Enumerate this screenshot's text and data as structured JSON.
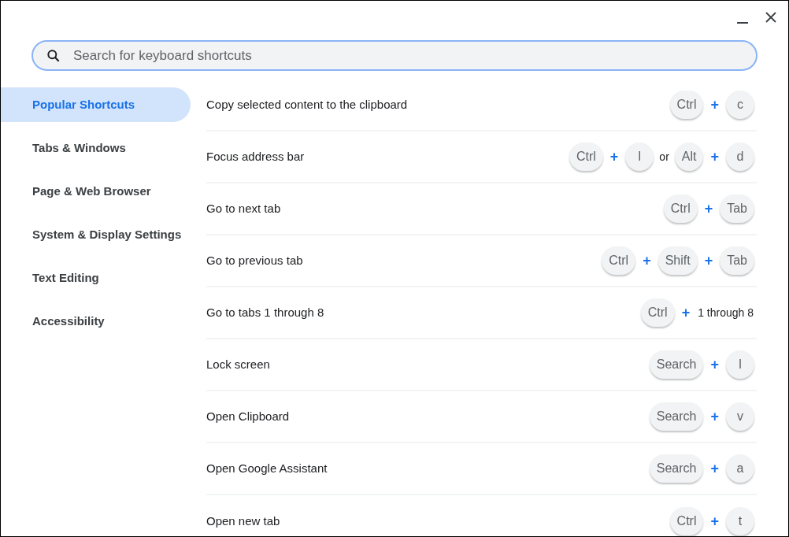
{
  "search": {
    "placeholder": "Search for keyboard shortcuts"
  },
  "sidebar": {
    "items": [
      {
        "label": "Popular Shortcuts",
        "selected": true
      },
      {
        "label": "Tabs & Windows",
        "selected": false
      },
      {
        "label": "Page & Web Browser",
        "selected": false
      },
      {
        "label": "System & Display Settings",
        "selected": false
      },
      {
        "label": "Text Editing",
        "selected": false
      },
      {
        "label": "Accessibility",
        "selected": false
      }
    ]
  },
  "shortcuts": [
    {
      "description": "Copy selected content to the clipboard",
      "keys": [
        {
          "kind": "key",
          "text": "Ctrl"
        },
        {
          "kind": "plus",
          "text": "+"
        },
        {
          "kind": "key",
          "text": "c"
        }
      ]
    },
    {
      "description": "Focus address bar",
      "keys": [
        {
          "kind": "key",
          "text": "Ctrl"
        },
        {
          "kind": "plus",
          "text": "+"
        },
        {
          "kind": "key",
          "text": "l"
        },
        {
          "kind": "text",
          "text": "or"
        },
        {
          "kind": "key",
          "text": "Alt"
        },
        {
          "kind": "plus",
          "text": "+"
        },
        {
          "kind": "key",
          "text": "d"
        }
      ]
    },
    {
      "description": "Go to next tab",
      "keys": [
        {
          "kind": "key",
          "text": "Ctrl"
        },
        {
          "kind": "plus",
          "text": "+"
        },
        {
          "kind": "key",
          "text": "Tab"
        }
      ]
    },
    {
      "description": "Go to previous tab",
      "keys": [
        {
          "kind": "key",
          "text": "Ctrl"
        },
        {
          "kind": "plus",
          "text": "+"
        },
        {
          "kind": "key",
          "text": "Shift"
        },
        {
          "kind": "plus",
          "text": "+"
        },
        {
          "kind": "key",
          "text": "Tab"
        }
      ]
    },
    {
      "description": "Go to tabs 1 through 8",
      "keys": [
        {
          "kind": "key",
          "text": "Ctrl"
        },
        {
          "kind": "plus",
          "text": "+"
        },
        {
          "kind": "text",
          "text": "1 through 8"
        }
      ]
    },
    {
      "description": "Lock screen",
      "keys": [
        {
          "kind": "key",
          "text": "Search"
        },
        {
          "kind": "plus",
          "text": "+"
        },
        {
          "kind": "key",
          "text": "l"
        }
      ]
    },
    {
      "description": "Open Clipboard",
      "keys": [
        {
          "kind": "key",
          "text": "Search"
        },
        {
          "kind": "plus",
          "text": "+"
        },
        {
          "kind": "key",
          "text": "v"
        }
      ]
    },
    {
      "description": "Open Google Assistant",
      "keys": [
        {
          "kind": "key",
          "text": "Search"
        },
        {
          "kind": "plus",
          "text": "+"
        },
        {
          "kind": "key",
          "text": "a"
        }
      ]
    },
    {
      "description": "Open new tab",
      "keys": [
        {
          "kind": "key",
          "text": "Ctrl"
        },
        {
          "kind": "plus",
          "text": "+"
        },
        {
          "kind": "key",
          "text": "t"
        }
      ]
    }
  ]
}
